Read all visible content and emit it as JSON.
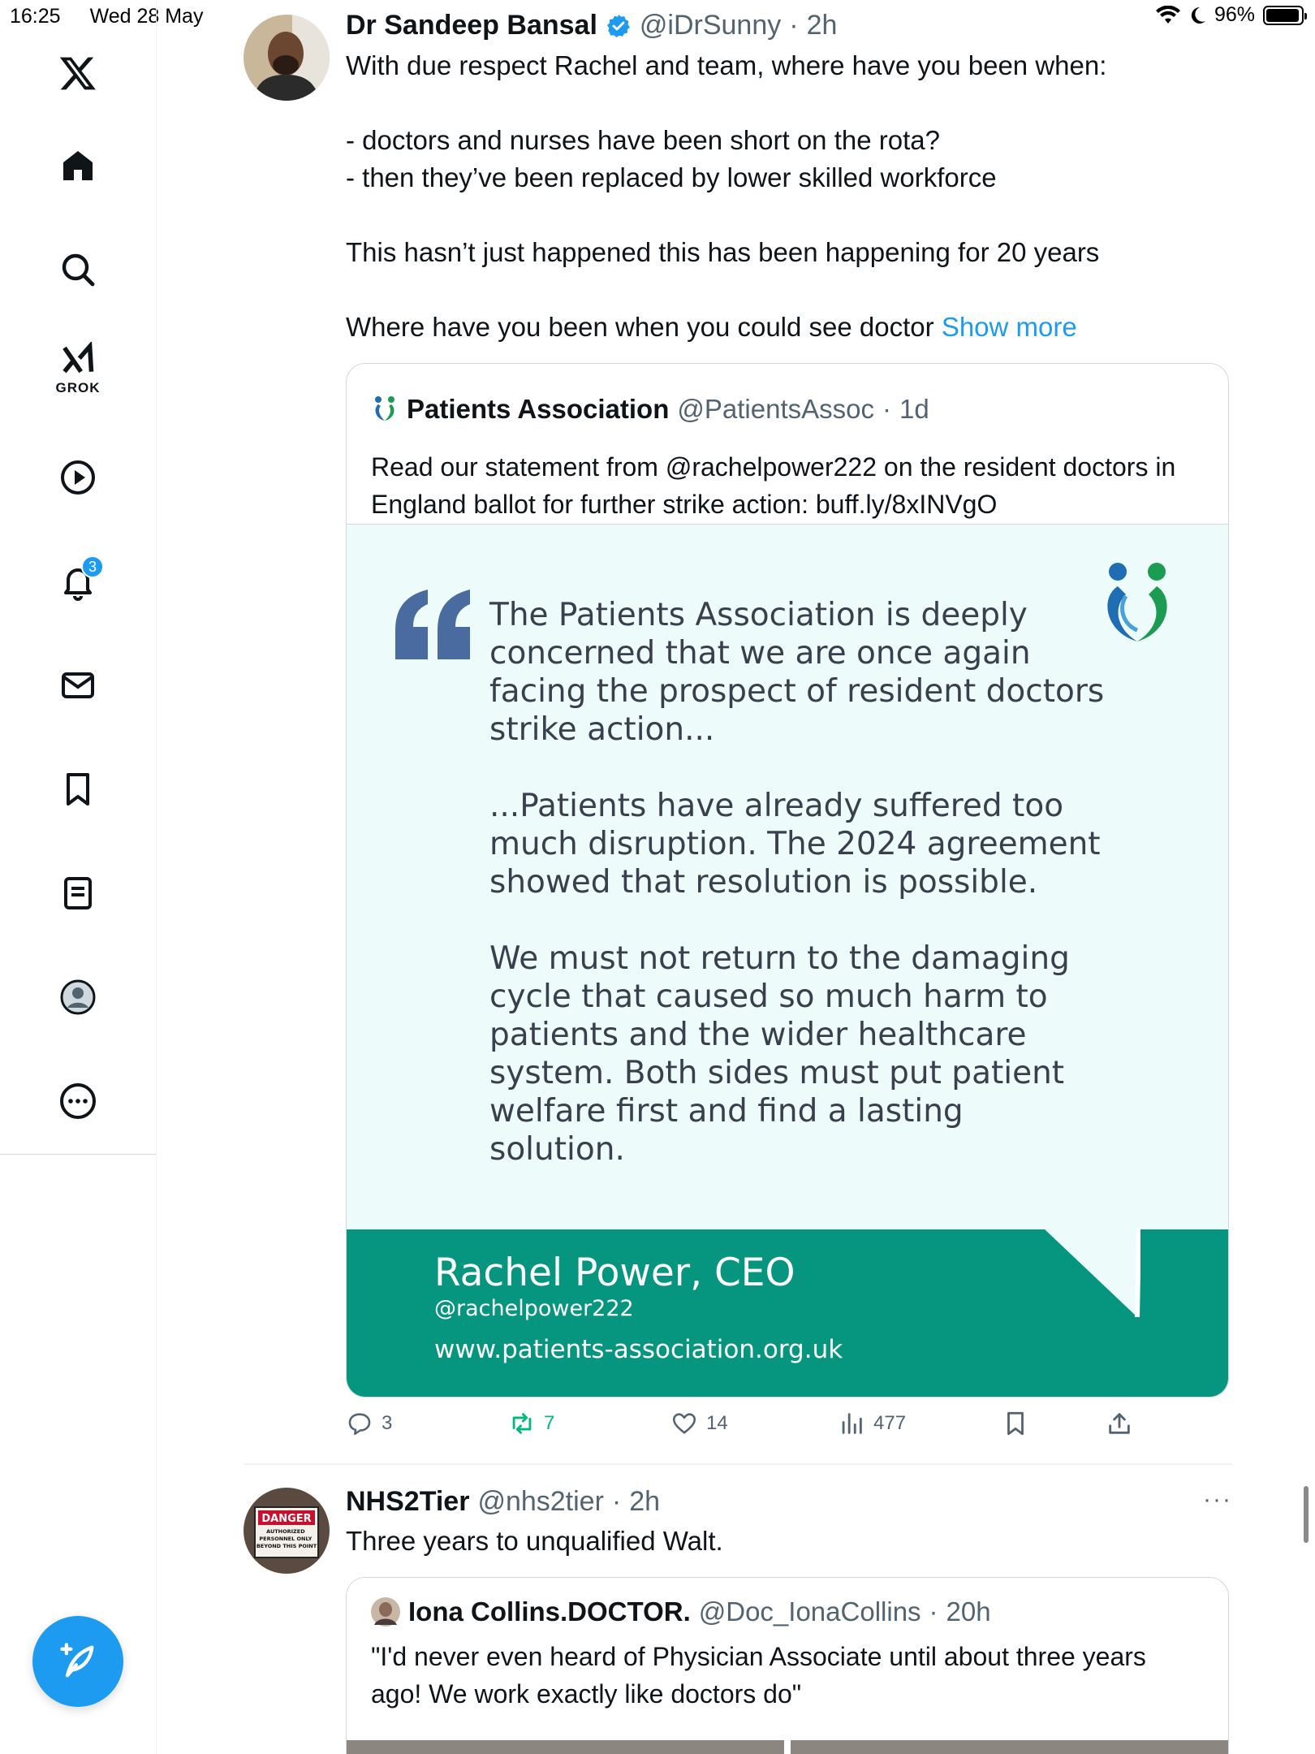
{
  "status_bar": {
    "time": "16:25",
    "date": "Wed 28 May",
    "battery": "96%",
    "battery_level": 0.96
  },
  "sidebar": {
    "items": [
      {
        "name": "home",
        "icon": "home-icon"
      },
      {
        "name": "explore",
        "icon": "search-icon"
      },
      {
        "name": "grok",
        "icon": "grok-icon",
        "label": "GROK"
      },
      {
        "name": "video",
        "icon": "play-icon"
      },
      {
        "name": "notifications",
        "icon": "bell-icon",
        "badge": "3"
      },
      {
        "name": "messages",
        "icon": "mail-icon"
      },
      {
        "name": "bookmarks",
        "icon": "bookmark-icon"
      },
      {
        "name": "lists",
        "icon": "list-icon"
      },
      {
        "name": "profile",
        "icon": "profile-icon"
      },
      {
        "name": "more",
        "icon": "more-icon"
      }
    ]
  },
  "colors": {
    "accent": "#1d9bf0",
    "green": "#06967f",
    "retweet": "#00ba7c",
    "muted": "#536471"
  },
  "tweet1": {
    "name": "Dr Sandeep Bansal",
    "handle": "@iDrSunny",
    "time": "2h",
    "body": "With due respect Rachel and team, where have you been when:\n\n- doctors and nurses have been short on the rota?\n- then they’ve been replaced by lower skilled workforce\n\nThis hasn’t just happened this has been happening for 20 years\n\nWhere have you been when you could see doctor ",
    "show_more": "Show more",
    "quote": {
      "name": "Patients Association",
      "handle": "@PatientsAssoc",
      "time": "1d",
      "body": "Read our statement from @rachelpower222 on the resident doctors in England ballot for further strike action: buff.ly/8xINVgO",
      "image_text": "The Patients Association is deeply concerned that we are once again facing the prospect of resident doctors strike action...\n\n...Patients have already suffered too much disruption. The 2024 agreement showed that resolution is possible.\n\nWe must not return to the damaging cycle that caused so much harm to patients and the wider healthcare system. Both sides must put patient welfare first and find a lasting solution.",
      "ceo_name": "Rachel Power, CEO",
      "ceo_handle": "@rachelpower222",
      "ceo_url": "www.patients-association.org.uk"
    },
    "actions": {
      "replies": "3",
      "reposts": "7",
      "likes": "14",
      "views": "477"
    }
  },
  "tweet2": {
    "name": "NHS2Tier",
    "handle": "@nhs2tier",
    "time": "2h",
    "body": "Three years to unqualified Walt.",
    "avatar_sign": {
      "title": "DANGER",
      "sub": "AUTHORIZED PERSONNEL ONLY BEYOND THIS POINT"
    },
    "quote": {
      "name": "Iona Collins.DOCTOR.",
      "handle": "@Doc_IonaCollins",
      "time": "20h",
      "body": "\"I'd never even heard of Physician Associate until about three years ago! We work exactly like doctors do\""
    }
  }
}
